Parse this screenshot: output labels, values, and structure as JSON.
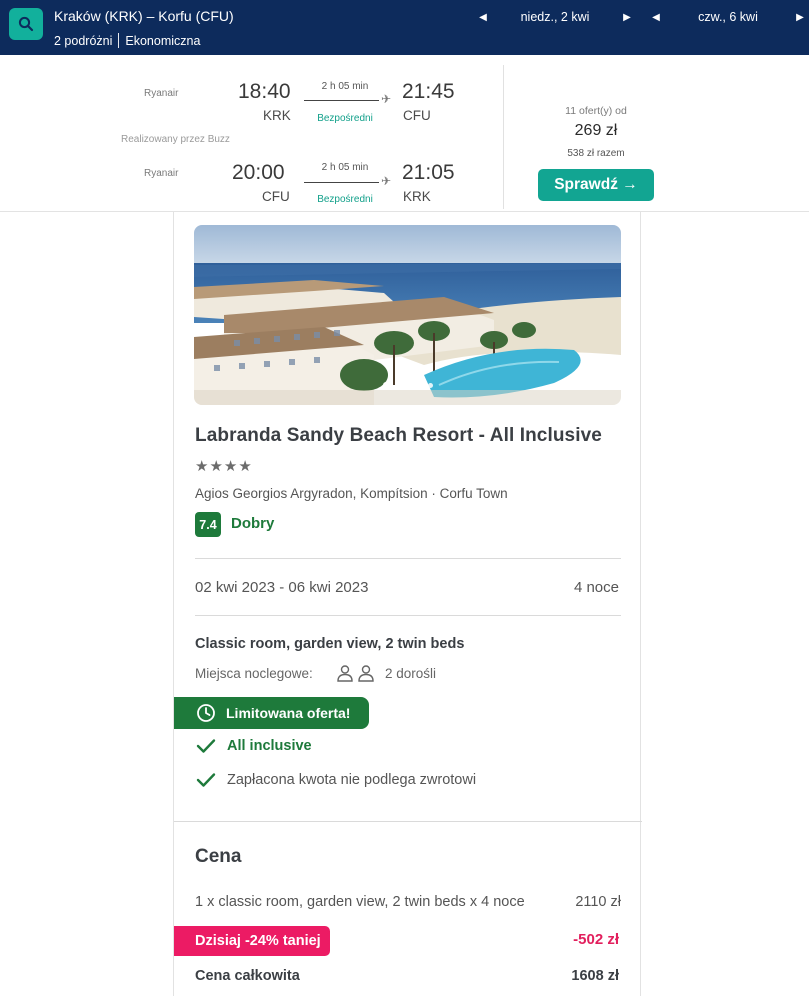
{
  "search": {
    "route": "Kraków (KRK) – Korfu (CFU)",
    "travellers": "2 podróżni",
    "cabin": "Ekonomiczna",
    "depart_date": "niedz., 2 kwi",
    "return_date": "czw., 6 kwi"
  },
  "flight": {
    "outbound": {
      "airline": "Ryanair",
      "dep_time": "18:40",
      "dep_code": "KRK",
      "duration": "2 h 05 min",
      "stops": "Bezpośredni",
      "arr_time": "21:45",
      "arr_code": "CFU"
    },
    "operated_by": "Realizowany przez Buzz",
    "inbound": {
      "airline": "Ryanair",
      "dep_time": "20:00",
      "dep_code": "CFU",
      "duration": "2 h 05 min",
      "stops": "Bezpośredni",
      "arr_time": "21:05",
      "arr_code": "KRK"
    },
    "offers": "11 ofert(y) od",
    "price": "269 zł",
    "total": "538 zł razem",
    "cta": "Sprawdź →"
  },
  "hotel": {
    "name": "Labranda Sandy Beach Resort - All Inclusive",
    "stars": "★★★★",
    "location": "Agios Georgios Argyradon, Kompítsion · Corfu Town",
    "rating_score": "7.4",
    "rating_label": "Dobry",
    "dates": "02 kwi 2023 - 06 kwi 2023",
    "nights": "4 noce",
    "room": "Classic room, garden view, 2 twin beds",
    "beds_label": "Miejsca noclegowe:",
    "beds_value": "2 dorośli",
    "limited_offer": "Limitowana oferta!",
    "features": [
      "All inclusive",
      "Zapłacona kwota nie podlega zwrotowi"
    ]
  },
  "pricing": {
    "title": "Cena",
    "line_desc": "1 x classic room, garden view, 2 twin beds x 4 noce",
    "line_amount": "2110 zł",
    "discount_label": "Dzisiaj -24% taniej",
    "discount_amount": "-502 zł",
    "total_label": "Cena całkowita",
    "total_amount": "1608 zł"
  },
  "colors": {
    "navy": "#0d2b5c",
    "teal": "#12a592",
    "green": "#1e7a3b",
    "pink": "#ec1b64"
  }
}
